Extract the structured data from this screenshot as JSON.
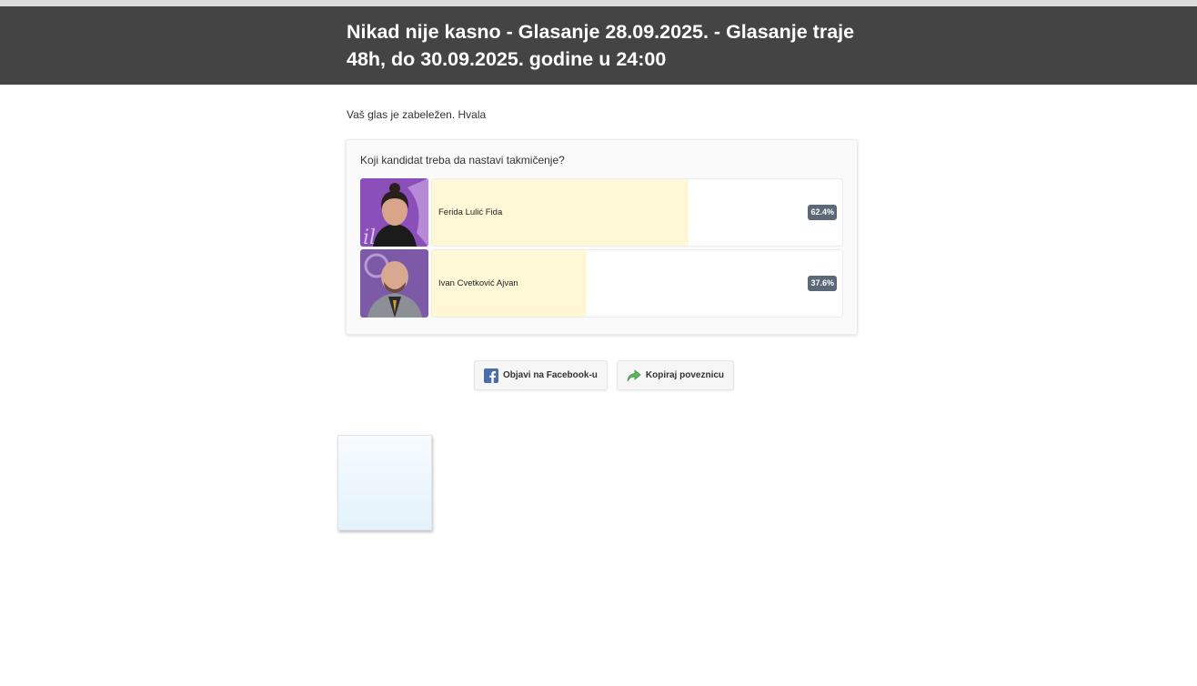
{
  "header": {
    "title": "Nikad nije kasno - Glasanje 28.09.2025. - Glasanje traje 48h, do 30.09.2025. godine u 24:00"
  },
  "message": "Vaš glas je zabeležen. Hvala",
  "poll": {
    "question": "Koji kandidat treba da nastavi takmičenje?",
    "options": [
      {
        "name": "Ferida Lulić Fida",
        "percent": 62.4,
        "percent_label": "62.4%"
      },
      {
        "name": "Ivan Cvetković Ajvan",
        "percent": 37.6,
        "percent_label": "37.6%"
      }
    ]
  },
  "share": {
    "facebook_label": "Objavi na Facebook-u",
    "copy_link_label": "Kopiraj poveznicu"
  },
  "colors": {
    "header_bg": "#444444",
    "bar_fill": "#fff8d6",
    "percent_badge": "#5a6877",
    "facebook_icon": "#4a6ea9",
    "share_arrow": "#5cb85c"
  }
}
